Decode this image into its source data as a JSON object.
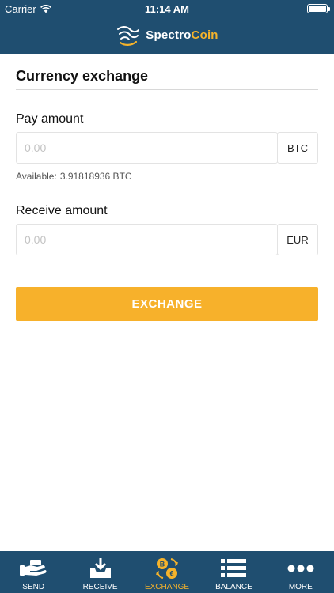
{
  "status_bar": {
    "carrier": "Carrier",
    "time": "11:14 AM"
  },
  "brand": {
    "name_part1": "Spectro",
    "name_part2": "Coin",
    "accent_color": "#f5b32b"
  },
  "colors": {
    "header": "#1f4e70",
    "button": "#f7b12b",
    "active_tab": "#f5b32b"
  },
  "page": {
    "title": "Currency exchange"
  },
  "pay": {
    "label": "Pay amount",
    "placeholder": "0.00",
    "value": "",
    "currency": "BTC"
  },
  "available": {
    "label": "Available:",
    "value": "3.91818936 BTC"
  },
  "receive": {
    "label": "Receive amount",
    "placeholder": "0.00",
    "value": "",
    "currency": "EUR"
  },
  "exchange_button": {
    "label": "EXCHANGE"
  },
  "tabs": [
    {
      "label": "SEND",
      "icon": "send-hand-icon",
      "active": false
    },
    {
      "label": "RECEIVE",
      "icon": "receive-tray-icon",
      "active": false
    },
    {
      "label": "EXCHANGE",
      "icon": "exchange-coins-icon",
      "active": true
    },
    {
      "label": "BALANCE",
      "icon": "balance-list-icon",
      "active": false
    },
    {
      "label": "MORE",
      "icon": "more-dots-icon",
      "active": false
    }
  ]
}
